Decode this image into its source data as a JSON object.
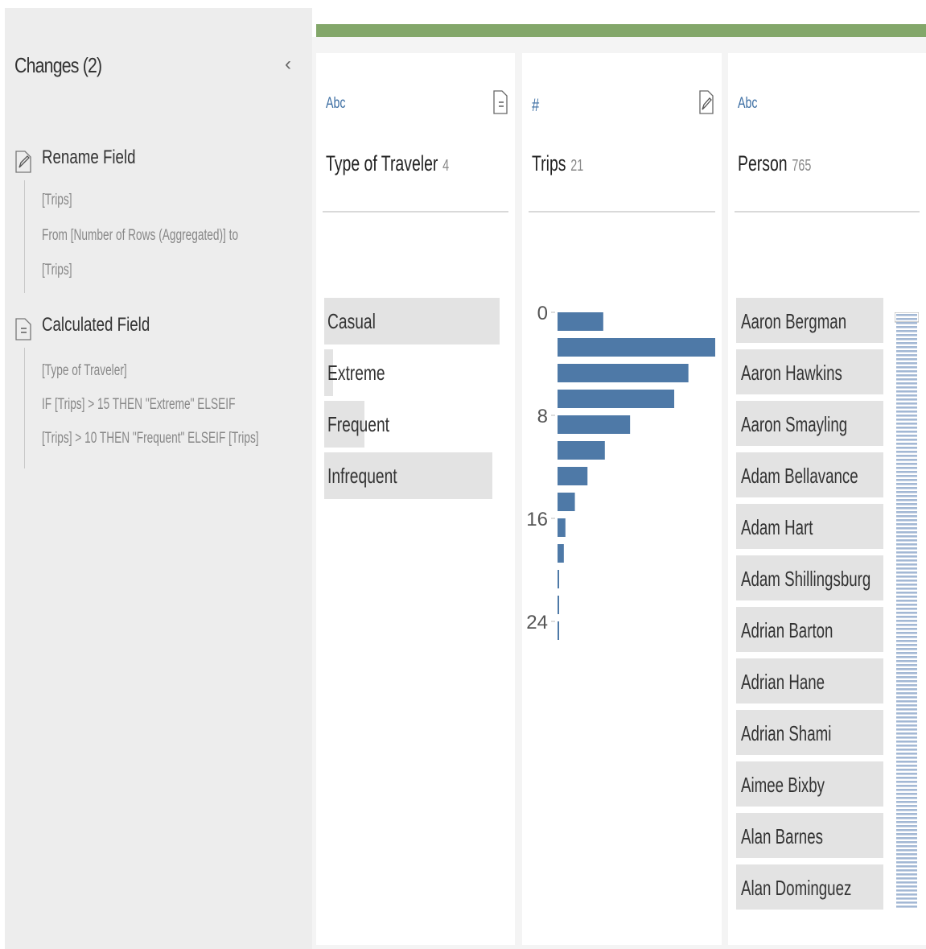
{
  "changes": {
    "title": "Changes (2)",
    "collapse_glyph": "‹",
    "items": [
      {
        "icon": "rename-pencil-icon",
        "title": "Rename Field",
        "lines": [
          "[Trips]",
          "From [Number of Rows (Aggregated)] to",
          "[Trips]"
        ]
      },
      {
        "icon": "calculated-field-icon",
        "title": "Calculated Field",
        "lines": [
          "[Type of Traveler]",
          "IF [Trips] > 15 THEN \"Extreme\" ELSEIF",
          "[Trips] > 10 THEN \"Frequent\" ELSEIF [Trips]"
        ]
      }
    ]
  },
  "cards": {
    "traveler": {
      "type_label": "Abc",
      "name": "Type of Traveler",
      "count": "4",
      "action_icon": "calculated-field-icon",
      "categories": [
        {
          "label": "Casual",
          "share": 1.0
        },
        {
          "label": "Extreme",
          "share": 0.05
        },
        {
          "label": "Frequent",
          "share": 0.23
        },
        {
          "label": "Infrequent",
          "share": 0.96
        }
      ]
    },
    "trips": {
      "type_label": "#",
      "name": "Trips",
      "count": "21",
      "action_icon": "edit-pencil-icon",
      "axis_ticks": [
        "0",
        "8",
        "16",
        "24"
      ]
    },
    "person": {
      "type_label": "Abc",
      "name": "Person",
      "count": "765",
      "names": [
        "Aaron Bergman",
        "Aaron Hawkins",
        "Aaron Smayling",
        "Adam Bellavance",
        "Adam Hart",
        "Adam Shillingsburg",
        "Adrian Barton",
        "Adrian Hane",
        "Adrian Shami",
        "Aimee Bixby",
        "Alan Barnes",
        "Alan Dominguez"
      ]
    }
  },
  "chart_data": {
    "type": "bar",
    "orientation": "horizontal",
    "y_ticks": [
      0,
      8,
      16,
      24
    ],
    "bins": [
      0,
      2,
      4,
      6,
      8,
      10,
      12,
      14,
      16,
      18,
      20,
      22,
      24
    ],
    "values": [
      29,
      100,
      83,
      74,
      46,
      30,
      19,
      11,
      5,
      4,
      1,
      0,
      1
    ],
    "color": "#4e79a7"
  },
  "colors": {
    "progress": "#83a76a",
    "bar": "#4e79a7",
    "type_label": "#3c6ea3"
  }
}
